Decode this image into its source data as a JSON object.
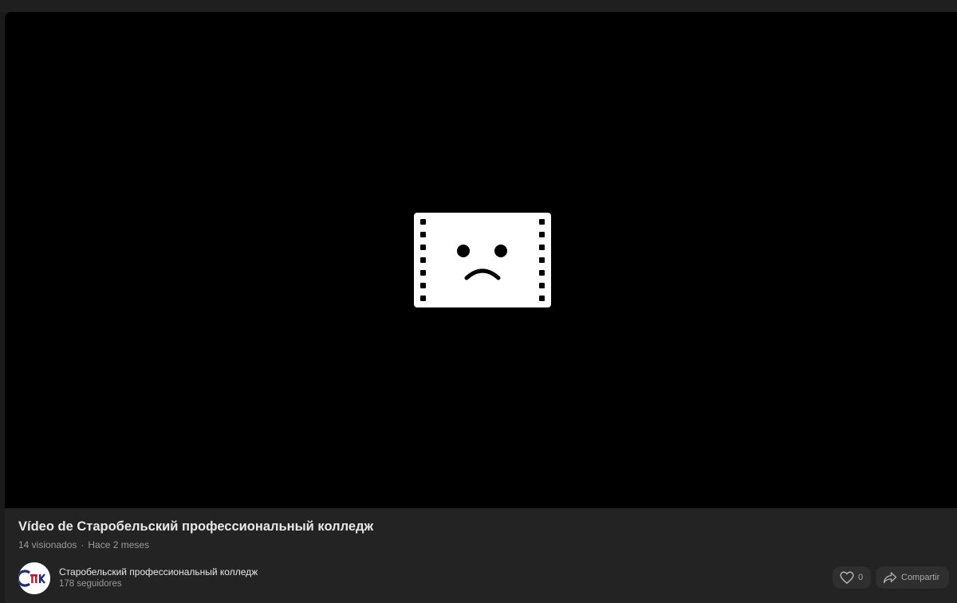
{
  "video": {
    "title": "Vídeo de Старобельский профессиональный колледж",
    "views": "14 visionados",
    "separator": "·",
    "age": "Hace 2 meses",
    "error_icon": "sad-film-icon"
  },
  "channel": {
    "name": "Старобельский профессиональный колледж",
    "followers": "178 seguidores",
    "avatar_logo_text": "СПК"
  },
  "actions": {
    "like_count": "0",
    "share_label": "Compartir"
  },
  "colors": {
    "player_bg": "#000000",
    "panel_bg": "#232323",
    "button_bg": "#2f2f2f",
    "title_text": "#e8e8e8",
    "meta_text": "#9a9a9a"
  }
}
